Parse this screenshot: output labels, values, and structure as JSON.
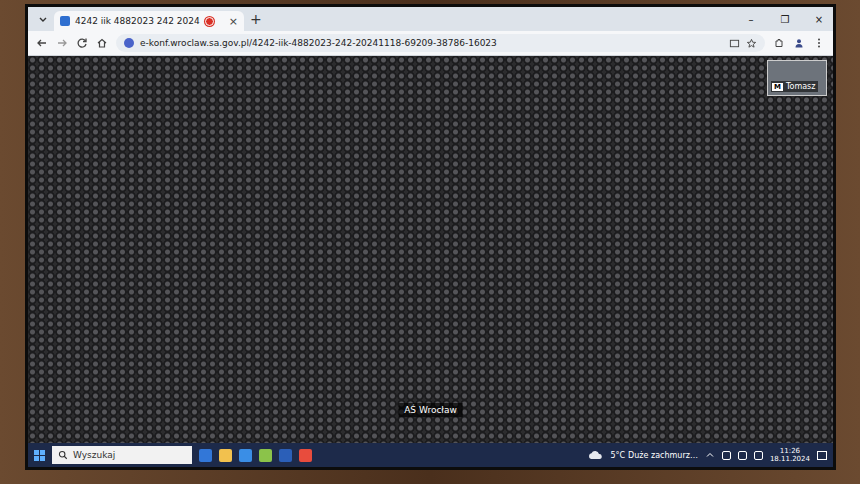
{
  "browser": {
    "tabs": [
      {
        "title": "4242 iik 4882023 242 2024",
        "selected": true,
        "recording": true,
        "close": "×"
      }
    ],
    "new_tab": "+",
    "window_controls": [
      "–",
      "❐",
      "×"
    ],
    "url": "e-konf.wroclaw.sa.gov.pl/4242-iik-4882023-242-20241118-69209-38786-16023"
  },
  "call": {
    "participant_label": "AŚ Wrocław",
    "self_view": {
      "badge": "M",
      "name": "Tomasz"
    }
  },
  "taskbar": {
    "search_placeholder": "Wyszukaj",
    "weather": {
      "temp": "5°C",
      "text": "Duże zachmurz…"
    },
    "clock": {
      "time": "11:26",
      "date": "18.11.2024"
    }
  }
}
